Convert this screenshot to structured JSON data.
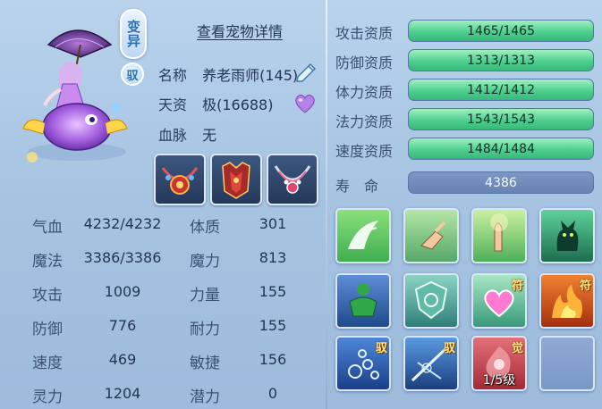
{
  "pet": {
    "variant_badge": "变异",
    "tame_badge": "驭",
    "detail_link": "查看宠物详情",
    "name_label": "名称",
    "name_value": "养老雨师(145)",
    "talent_label": "天资",
    "talent_value": "极(16688)",
    "blood_label": "血脉",
    "blood_value": "无"
  },
  "equipment": [
    {
      "icon": "necklace-red-icon"
    },
    {
      "icon": "armor-red-icon"
    },
    {
      "icon": "necklace-silver-icon"
    }
  ],
  "stats_left": [
    {
      "label": "气血",
      "value": "4232/4232"
    },
    {
      "label": "魔法",
      "value": "3386/3386"
    },
    {
      "label": "攻击",
      "value": "1009"
    },
    {
      "label": "防御",
      "value": "776"
    },
    {
      "label": "速度",
      "value": "469"
    },
    {
      "label": "灵力",
      "value": "1204"
    }
  ],
  "stats_right": [
    {
      "label": "体质",
      "value": "301"
    },
    {
      "label": "魔力",
      "value": "813"
    },
    {
      "label": "力量",
      "value": "155"
    },
    {
      "label": "耐力",
      "value": "155"
    },
    {
      "label": "敏捷",
      "value": "156"
    },
    {
      "label": "潜力",
      "value": "0"
    }
  ],
  "aptitudes": [
    {
      "label": "攻击资质",
      "value": "1465/1465",
      "fill": 1.0
    },
    {
      "label": "防御资质",
      "value": "1313/1313",
      "fill": 1.0
    },
    {
      "label": "体力资质",
      "value": "1412/1412",
      "fill": 1.0
    },
    {
      "label": "法力资质",
      "value": "1543/1543",
      "fill": 1.0
    },
    {
      "label": "速度资质",
      "value": "1484/1484",
      "fill": 1.0
    }
  ],
  "lifespan": {
    "label": "寿　命",
    "value": "4386"
  },
  "skills": [
    {
      "icon": "white-wings-skill-icon",
      "tag": ""
    },
    {
      "icon": "pointing-hand-skill-icon",
      "tag": ""
    },
    {
      "icon": "praying-hand-skill-icon",
      "tag": ""
    },
    {
      "icon": "green-cat-skill-icon",
      "tag": ""
    },
    {
      "icon": "green-giant-skill-icon",
      "tag": ""
    },
    {
      "icon": "shield-skill-icon",
      "tag": ""
    },
    {
      "icon": "heart-skill-icon",
      "tag": "符"
    },
    {
      "icon": "fire-skill-icon",
      "tag": "符"
    },
    {
      "icon": "water-bubbles-skill-icon",
      "tag": "驭"
    },
    {
      "icon": "ice-slash-skill-icon",
      "tag": "驭"
    },
    {
      "icon": "awaken-skill-icon",
      "tag": "觉",
      "level": "1/5级"
    },
    {
      "icon": "empty-slot",
      "tag": ""
    }
  ],
  "colors": {
    "background": "#a7c4e2",
    "aptitude_fill": "#4fcf8f",
    "lifespan_bar": "#6f8cbb",
    "text": "#233654"
  }
}
